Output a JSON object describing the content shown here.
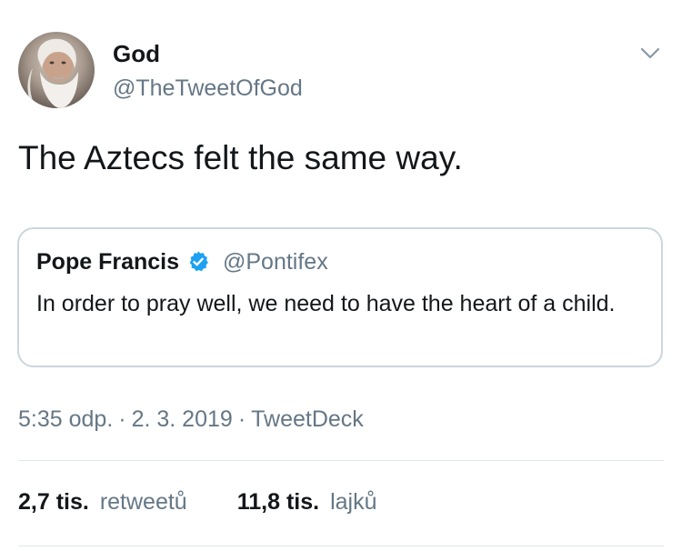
{
  "tweet": {
    "author": {
      "display_name": "God",
      "handle": "@TheTweetOfGod",
      "avatar_icon": "bearded-man-avatar"
    },
    "text": "The Aztecs felt the same way.",
    "quoted": {
      "display_name": "Pope Francis",
      "verified": true,
      "verified_icon": "verified-badge-icon",
      "handle": "@Pontifex",
      "text": "In order to pray well, we need to have the heart of a child."
    },
    "time": "5:35 odp.",
    "date": "2. 3. 2019",
    "separator": "·",
    "source": "TweetDeck",
    "stats": {
      "retweets_count": "2,7 tis.",
      "retweets_label": "retweetů",
      "likes_count": "11,8 tis.",
      "likes_label": "lajků"
    }
  },
  "colors": {
    "text_primary": "#14171a",
    "text_secondary": "#657786",
    "border": "#ccd6dd",
    "divider": "#e1e8ed",
    "verified_blue": "#1da1f2"
  }
}
